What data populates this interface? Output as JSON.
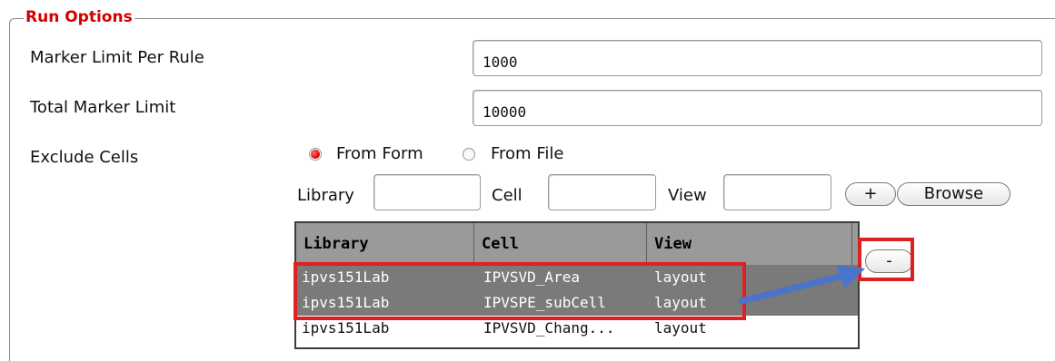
{
  "group": {
    "title": "Run Options"
  },
  "fields": {
    "marker_limit_per_rule": {
      "label": "Marker Limit Per Rule",
      "value": "1000"
    },
    "total_marker_limit": {
      "label": "Total Marker Limit",
      "value": "10000"
    },
    "exclude_cells": {
      "label": "Exclude Cells",
      "options": [
        "From Form",
        "From File"
      ],
      "selected": "From Form"
    }
  },
  "exclude_inputs": {
    "library_label": "Library",
    "cell_label": "Cell",
    "view_label": "View",
    "library_value": "",
    "cell_value": "",
    "view_value": ""
  },
  "buttons": {
    "add": "+",
    "browse": "Browse",
    "remove": "-"
  },
  "table": {
    "headers": [
      "Library",
      "Cell",
      "View"
    ],
    "rows": [
      {
        "library": "ipvs151Lab",
        "cell": "IPVSVD_Area",
        "view": "layout",
        "selected": true
      },
      {
        "library": "ipvs151Lab",
        "cell": "IPVSPE_subCell",
        "view": "layout",
        "selected": true
      },
      {
        "library": "ipvs151Lab",
        "cell": "IPVSVD_Chang...",
        "view": "layout",
        "selected": false
      }
    ]
  },
  "colors": {
    "accent_red": "#d40000",
    "annotation_red": "#e02020",
    "annotation_arrow": "#4a74c9",
    "header_gray": "#9a9a9a",
    "selection_gray": "#7a7a7a"
  }
}
